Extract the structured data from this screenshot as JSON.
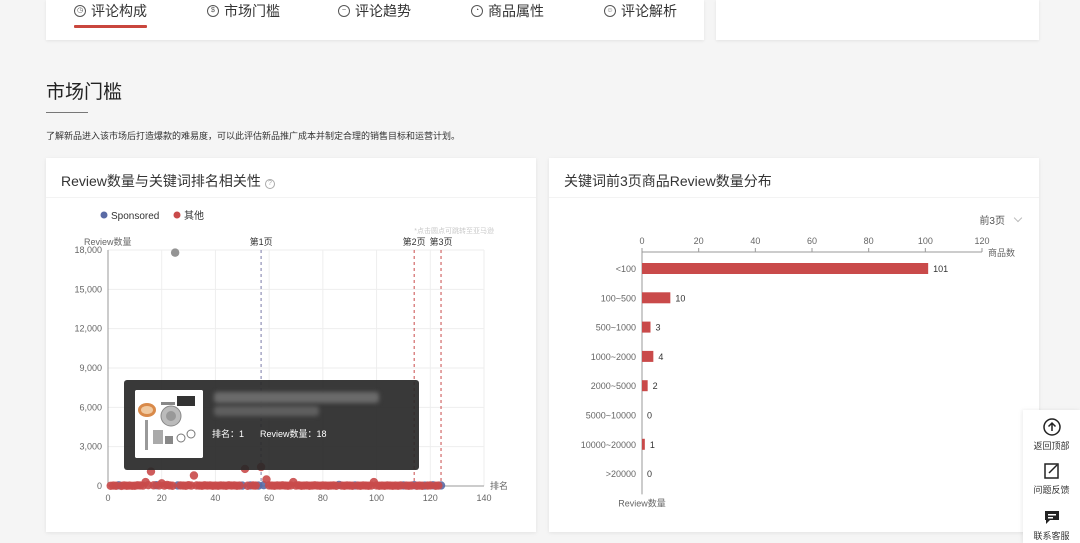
{
  "tabs": [
    {
      "label": "评论构成",
      "icon": "clock-icon",
      "active": true
    },
    {
      "label": "市场门槛",
      "icon": "dollar-icon",
      "active": false
    },
    {
      "label": "评论趋势",
      "icon": "trend-icon",
      "active": false
    },
    {
      "label": "商品属性",
      "icon": "pie-icon",
      "active": false
    },
    {
      "label": "评论解析",
      "icon": "smile-icon",
      "active": false
    }
  ],
  "section": {
    "title": "市场门槛",
    "description": "了解新品进入该市场后打造爆款的难易度，可以此评估新品推广成本并制定合理的销售目标和运营计划。"
  },
  "left_card": {
    "title": "Review数量与关键词排名相关性",
    "help_icon": "question-circle-icon",
    "hint": "*点击圆点可跳转至亚马逊",
    "tooltip": {
      "rank_label": "排名：1",
      "review_label": "Review数量：18"
    }
  },
  "right_card": {
    "title": "关键词前3页商品Review数量分布",
    "dropdown_value": "前3页"
  },
  "chart_data": [
    {
      "type": "scatter",
      "legend": [
        "Sponsored",
        "其他"
      ],
      "legend_position": "top-left",
      "colors": {
        "Sponsored": "#5a6aa5",
        "其他": "#c94a4a"
      },
      "ylabel": "Review数量",
      "xlabel": "排名",
      "xlim": [
        0,
        140
      ],
      "ylim": [
        0,
        18000
      ],
      "xticks": [
        0,
        20,
        40,
        60,
        80,
        100,
        120,
        140
      ],
      "yticks": [
        0,
        3000,
        6000,
        9000,
        12000,
        15000,
        18000
      ],
      "page_markers": [
        {
          "label": "第1页",
          "x": 57
        },
        {
          "label": "第2页",
          "x": 114
        },
        {
          "label": "第3页",
          "x": 124
        }
      ],
      "series": [
        {
          "name": "Sponsored",
          "points": [
            [
              25,
              17800
            ],
            [
              4,
              50
            ],
            [
              18,
              60
            ],
            [
              26,
              40
            ],
            [
              50,
              30
            ],
            [
              53,
              40
            ],
            [
              56,
              30
            ],
            [
              58,
              60
            ],
            [
              86,
              80
            ],
            [
              92,
              40
            ],
            [
              110,
              40
            ],
            [
              114,
              60
            ],
            [
              118,
              30
            ],
            [
              121,
              50
            ],
            [
              124,
              40
            ]
          ]
        },
        {
          "name": "其他",
          "points": [
            [
              1,
              18
            ],
            [
              2,
              30
            ],
            [
              3,
              20
            ],
            [
              5,
              10
            ],
            [
              6,
              40
            ],
            [
              7,
              20
            ],
            [
              8,
              30
            ],
            [
              9,
              15
            ],
            [
              10,
              20
            ],
            [
              11,
              50
            ],
            [
              12,
              40
            ],
            [
              13,
              30
            ],
            [
              14,
              300
            ],
            [
              15,
              60
            ],
            [
              16,
              1100
            ],
            [
              17,
              50
            ],
            [
              19,
              40
            ],
            [
              20,
              200
            ],
            [
              21,
              30
            ],
            [
              22,
              80
            ],
            [
              23,
              40
            ],
            [
              24,
              20
            ],
            [
              27,
              40
            ],
            [
              28,
              30
            ],
            [
              29,
              20
            ],
            [
              30,
              60
            ],
            [
              31,
              30
            ],
            [
              32,
              800
            ],
            [
              33,
              40
            ],
            [
              34,
              30
            ],
            [
              35,
              20
            ],
            [
              36,
              50
            ],
            [
              37,
              30
            ],
            [
              38,
              40
            ],
            [
              39,
              20
            ],
            [
              40,
              30
            ],
            [
              41,
              20
            ],
            [
              42,
              40
            ],
            [
              43,
              30
            ],
            [
              44,
              20
            ],
            [
              45,
              50
            ],
            [
              46,
              30
            ],
            [
              47,
              40
            ],
            [
              48,
              20
            ],
            [
              49,
              30
            ],
            [
              51,
              1300
            ],
            [
              52,
              20
            ],
            [
              54,
              40
            ],
            [
              55,
              30
            ],
            [
              57,
              1450
            ],
            [
              59,
              500
            ],
            [
              60,
              40
            ],
            [
              61,
              30
            ],
            [
              62,
              20
            ],
            [
              63,
              40
            ],
            [
              64,
              30
            ],
            [
              65,
              50
            ],
            [
              66,
              30
            ],
            [
              67,
              20
            ],
            [
              68,
              40
            ],
            [
              69,
              300
            ],
            [
              70,
              30
            ],
            [
              71,
              50
            ],
            [
              72,
              20
            ],
            [
              73,
              30
            ],
            [
              74,
              40
            ],
            [
              75,
              20
            ],
            [
              76,
              30
            ],
            [
              77,
              50
            ],
            [
              78,
              30
            ],
            [
              79,
              20
            ],
            [
              80,
              40
            ],
            [
              81,
              30
            ],
            [
              82,
              20
            ],
            [
              83,
              30
            ],
            [
              84,
              40
            ],
            [
              85,
              20
            ],
            [
              87,
              30
            ],
            [
              88,
              20
            ],
            [
              89,
              40
            ],
            [
              90,
              30
            ],
            [
              91,
              20
            ],
            [
              93,
              30
            ],
            [
              94,
              20
            ],
            [
              95,
              40
            ],
            [
              96,
              30
            ],
            [
              97,
              20
            ],
            [
              98,
              30
            ],
            [
              99,
              300
            ],
            [
              100,
              40
            ],
            [
              101,
              20
            ],
            [
              102,
              30
            ],
            [
              103,
              20
            ],
            [
              104,
              40
            ],
            [
              105,
              30
            ],
            [
              106,
              20
            ],
            [
              107,
              30
            ],
            [
              108,
              20
            ],
            [
              109,
              40
            ],
            [
              111,
              30
            ],
            [
              112,
              20
            ],
            [
              113,
              30
            ],
            [
              115,
              20
            ],
            [
              116,
              30
            ],
            [
              117,
              20
            ],
            [
              119,
              30
            ],
            [
              120,
              40
            ],
            [
              122,
              20
            ],
            [
              123,
              30
            ]
          ]
        }
      ]
    },
    {
      "type": "bar",
      "orientation": "horizontal",
      "categories": [
        "<100",
        "100~500",
        "500~1000",
        "1000~2000",
        "2000~5000",
        "5000~10000",
        "10000~20000",
        ">20000"
      ],
      "values": [
        101,
        10,
        3,
        4,
        2,
        0,
        1,
        0
      ],
      "xlabel": "商品数",
      "ylabel": "Review数量",
      "xlim": [
        0,
        120
      ],
      "xticks": [
        0,
        20,
        40,
        60,
        80,
        100,
        120
      ],
      "color": "#c94a4a"
    }
  ],
  "float_bar": [
    {
      "label": "返回顶部",
      "icon": "arrow-up-circle-icon"
    },
    {
      "label": "问题反馈",
      "icon": "edit-icon"
    },
    {
      "label": "联系客服",
      "icon": "chat-icon"
    }
  ]
}
